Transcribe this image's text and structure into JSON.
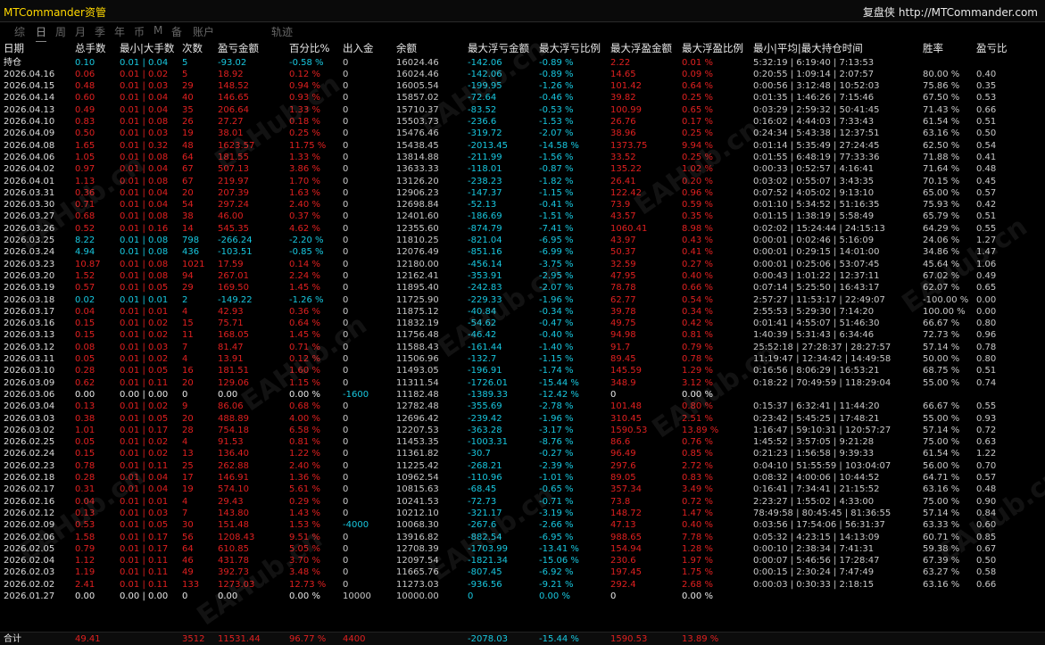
{
  "window": {
    "app_title": "MTCommander资管",
    "right_title": "复盘侠",
    "url": "http://MTCommander.com"
  },
  "tabs": [
    {
      "label": "综",
      "active": false
    },
    {
      "label": "日",
      "active": true
    },
    {
      "label": "周",
      "active": false
    },
    {
      "label": "月",
      "active": false
    },
    {
      "label": "季",
      "active": false
    },
    {
      "label": "年",
      "active": false
    },
    {
      "label": "币",
      "active": false
    },
    {
      "label": "M",
      "active": false
    },
    {
      "label": "备",
      "active": false
    },
    {
      "label": "账户",
      "active": false
    },
    {
      "label": "轨迹",
      "active": false
    }
  ],
  "headers": [
    "日期",
    "总手数",
    "最小|大手数",
    "次数",
    "盈亏金额",
    "百分比%",
    "出入金",
    "余额",
    "最大浮亏金额",
    "最大浮亏比例",
    "最大浮盈金额",
    "最大浮盈比例",
    "最小|平均|最大持仓时间",
    "胜率",
    "盈亏比"
  ],
  "rows": [
    [
      "持仓",
      "0.10",
      "0.01 | 0.04",
      "5",
      "-93.02",
      "-0.58 %",
      "0",
      "16024.46",
      "-142.06",
      "-0.89 %",
      "2.22",
      "0.01 %",
      "5:32:19 | 6:19:40 | 7:13:53",
      "",
      ""
    ],
    [
      "2026.04.16",
      "0.06",
      "0.01 | 0.02",
      "5",
      "18.92",
      "0.12 %",
      "0",
      "16024.46",
      "-142.06",
      "-0.89 %",
      "14.65",
      "0.09 %",
      "0:20:55 | 1:09:14 | 2:07:57",
      "80.00 %",
      "0.40"
    ],
    [
      "2026.04.15",
      "0.48",
      "0.01 | 0.03",
      "29",
      "148.52",
      "0.94 %",
      "0",
      "16005.54",
      "-199.95",
      "-1.26 %",
      "101.42",
      "0.64 %",
      "0:00:56 | 3:12:48 | 10:52:03",
      "75.86 %",
      "0.35"
    ],
    [
      "2026.04.14",
      "0.60",
      "0.01 | 0.04",
      "40",
      "146.65",
      "0.93 %",
      "0",
      "15857.02",
      "-72.64",
      "-0.46 %",
      "39.82",
      "0.25 %",
      "0:01:35 | 1:46:26 | 7:15:46",
      "67.50 %",
      "0.53"
    ],
    [
      "2026.04.13",
      "0.49",
      "0.01 | 0.04",
      "35",
      "206.64",
      "1.33 %",
      "0",
      "15710.37",
      "-83.52",
      "-0.53 %",
      "100.99",
      "0.65 %",
      "0:03:29 | 2:59:32 | 50:41:45",
      "71.43 %",
      "0.66"
    ],
    [
      "2026.04.10",
      "0.83",
      "0.01 | 0.08",
      "26",
      "27.27",
      "0.18 %",
      "0",
      "15503.73",
      "-236.6",
      "-1.53 %",
      "26.76",
      "0.17 %",
      "0:16:02 | 4:44:03 | 7:33:43",
      "61.54 %",
      "0.51"
    ],
    [
      "2026.04.09",
      "0.50",
      "0.01 | 0.03",
      "19",
      "38.01",
      "0.25 %",
      "0",
      "15476.46",
      "-319.72",
      "-2.07 %",
      "38.96",
      "0.25 %",
      "0:24:34 | 5:43:38 | 12:37:51",
      "63.16 %",
      "0.50"
    ],
    [
      "2026.04.08",
      "1.65",
      "0.01 | 0.32",
      "48",
      "1623.57",
      "11.75 %",
      "0",
      "15438.45",
      "-2013.45",
      "-14.58 %",
      "1373.75",
      "9.94 %",
      "0:01:14 | 5:35:49 | 27:24:45",
      "62.50 %",
      "0.54"
    ],
    [
      "2026.04.06",
      "1.05",
      "0.01 | 0.08",
      "64",
      "181.55",
      "1.33 %",
      "0",
      "13814.88",
      "-211.99",
      "-1.56 %",
      "33.52",
      "0.25 %",
      "0:01:55 | 6:48:19 | 77:33:36",
      "71.88 %",
      "0.41"
    ],
    [
      "2026.04.02",
      "0.97",
      "0.01 | 0.04",
      "67",
      "507.13",
      "3.86 %",
      "0",
      "13633.33",
      "-118.01",
      "-0.87 %",
      "135.22",
      "1.02 %",
      "0:00:33 | 0:52:57 | 4:16:41",
      "71.64 %",
      "0.48"
    ],
    [
      "2026.04.01",
      "1.13",
      "0.01 | 0.08",
      "67",
      "219.97",
      "1.70 %",
      "0",
      "13126.20",
      "-238.23",
      "-1.82 %",
      "26.41",
      "0.20 %",
      "0:03:02 | 0:55:07 | 3:43:35",
      "70.15 %",
      "0.45"
    ],
    [
      "2026.03.31",
      "0.36",
      "0.01 | 0.04",
      "20",
      "207.39",
      "1.63 %",
      "0",
      "12906.23",
      "-147.37",
      "-1.15 %",
      "122.42",
      "0.96 %",
      "0:07:52 | 4:05:02 | 9:13:10",
      "65.00 %",
      "0.57"
    ],
    [
      "2026.03.30",
      "0.71",
      "0.01 | 0.04",
      "54",
      "297.24",
      "2.40 %",
      "0",
      "12698.84",
      "-52.13",
      "-0.41 %",
      "73.9",
      "0.59 %",
      "0:01:10 | 5:34:52 | 51:16:35",
      "75.93 %",
      "0.42"
    ],
    [
      "2026.03.27",
      "0.68",
      "0.01 | 0.08",
      "38",
      "46.00",
      "0.37 %",
      "0",
      "12401.60",
      "-186.69",
      "-1.51 %",
      "43.57",
      "0.35 %",
      "0:01:15 | 1:38:19 | 5:58:49",
      "65.79 %",
      "0.51"
    ],
    [
      "2026.03.26",
      "0.52",
      "0.01 | 0.16",
      "14",
      "545.35",
      "4.62 %",
      "0",
      "12355.60",
      "-874.79",
      "-7.41 %",
      "1060.41",
      "8.98 %",
      "0:02:02 | 15:24:44 | 24:15:13",
      "64.29 %",
      "0.55"
    ],
    [
      "2026.03.25",
      "8.22",
      "0.01 | 0.08",
      "798",
      "-266.24",
      "-2.20 %",
      "0",
      "11810.25",
      "-821.04",
      "-6.95 %",
      "43.97",
      "0.43 %",
      "0:00:01 | 0:02:46 | 5:16:09",
      "24.06 %",
      "1.27"
    ],
    [
      "2026.03.24",
      "4.94",
      "0.01 | 0.08",
      "436",
      "-103.51",
      "-0.85 %",
      "0",
      "12076.49",
      "-851.16",
      "-6.99 %",
      "50.37",
      "0.41 %",
      "0:00:01 | 0:29:15 | 14:01:00",
      "34.86 %",
      "1.47"
    ],
    [
      "2026.03.23",
      "10.87",
      "0.01 | 0.08",
      "1021",
      "17.59",
      "0.14 %",
      "0",
      "12180.00",
      "-456.14",
      "-3.75 %",
      "32.59",
      "0.27 %",
      "0:00:01 | 0:25:06 | 53:07:45",
      "45.64 %",
      "1.06"
    ],
    [
      "2026.03.20",
      "1.52",
      "0.01 | 0.08",
      "94",
      "267.01",
      "2.24 %",
      "0",
      "12162.41",
      "-353.91",
      "-2.95 %",
      "47.95",
      "0.40 %",
      "0:00:43 | 1:01:22 | 12:37:11",
      "67.02 %",
      "0.49"
    ],
    [
      "2026.03.19",
      "0.57",
      "0.01 | 0.05",
      "29",
      "169.50",
      "1.45 %",
      "0",
      "11895.40",
      "-242.83",
      "-2.07 %",
      "78.78",
      "0.66 %",
      "0:07:14 | 5:25:50 | 16:43:17",
      "62.07 %",
      "0.65"
    ],
    [
      "2026.03.18",
      "0.02",
      "0.01 | 0.01",
      "2",
      "-149.22",
      "-1.26 %",
      "0",
      "11725.90",
      "-229.33",
      "-1.96 %",
      "62.77",
      "0.54 %",
      "2:57:27 | 11:53:17 | 22:49:07",
      "-100.00 %",
      "0.00"
    ],
    [
      "2026.03.17",
      "0.04",
      "0.01 | 0.01",
      "4",
      "42.93",
      "0.36 %",
      "0",
      "11875.12",
      "-40.84",
      "-0.34 %",
      "39.78",
      "0.34 %",
      "2:55:53 | 5:29:30 | 7:14:20",
      "100.00 %",
      "0.00"
    ],
    [
      "2026.03.16",
      "0.15",
      "0.01 | 0.02",
      "15",
      "75.71",
      "0.64 %",
      "0",
      "11832.19",
      "-54.62",
      "-0.47 %",
      "49.75",
      "0.42 %",
      "0:01:41 | 4:55:07 | 51:46:30",
      "66.67 %",
      "0.80"
    ],
    [
      "2026.03.13",
      "0.15",
      "0.01 | 0.02",
      "11",
      "168.05",
      "1.45 %",
      "0",
      "11756.48",
      "-46.42",
      "-0.40 %",
      "94.98",
      "0.81 %",
      "1:40:39 | 5:31:43 | 6:34:46",
      "72.73 %",
      "0.96"
    ],
    [
      "2026.03.12",
      "0.08",
      "0.01 | 0.03",
      "7",
      "81.47",
      "0.71 %",
      "0",
      "11588.43",
      "-161.44",
      "-1.40 %",
      "91.7",
      "0.79 %",
      "25:52:18 | 27:28:37 | 28:27:57",
      "57.14 %",
      "0.78"
    ],
    [
      "2026.03.11",
      "0.05",
      "0.01 | 0.02",
      "4",
      "13.91",
      "0.12 %",
      "0",
      "11506.96",
      "-132.7",
      "-1.15 %",
      "89.45",
      "0.78 %",
      "11:19:47 | 12:34:42 | 14:49:58",
      "50.00 %",
      "0.80"
    ],
    [
      "2026.03.10",
      "0.28",
      "0.01 | 0.05",
      "16",
      "181.51",
      "1.60 %",
      "0",
      "11493.05",
      "-196.91",
      "-1.74 %",
      "145.59",
      "1.29 %",
      "0:16:56 | 8:06:29 | 16:53:21",
      "68.75 %",
      "0.51"
    ],
    [
      "2026.03.09",
      "0.62",
      "0.01 | 0.11",
      "20",
      "129.06",
      "1.15 %",
      "0",
      "11311.54",
      "-1726.01",
      "-15.44 %",
      "348.9",
      "3.12 %",
      "0:18:22 | 70:49:59 | 118:29:04",
      "55.00 %",
      "0.74"
    ],
    [
      "2026.03.06",
      "0.00",
      "0.00 | 0.00",
      "0",
      "0.00",
      "0.00 %",
      "-1600",
      "11182.48",
      "-1389.33",
      "-12.42 %",
      "0",
      "0.00 %",
      "",
      "",
      ""
    ],
    [
      "2026.03.04",
      "0.13",
      "0.01 | 0.02",
      "9",
      "86.06",
      "0.68 %",
      "0",
      "12782.48",
      "-355.69",
      "-2.78 %",
      "101.48",
      "0.80 %",
      "0:15:37 | 6:32:41 | 11:44:20",
      "66.67 %",
      "0.55"
    ],
    [
      "2026.03.03",
      "0.38",
      "0.01 | 0.05",
      "20",
      "488.89",
      "4.00 %",
      "0",
      "12696.42",
      "-239.42",
      "-1.96 %",
      "310.45",
      "2.51 %",
      "0:23:42 | 5:45:25 | 17:48:21",
      "55.00 %",
      "0.93"
    ],
    [
      "2026.03.02",
      "1.01",
      "0.01 | 0.17",
      "28",
      "754.18",
      "6.58 %",
      "0",
      "12207.53",
      "-363.28",
      "-3.17 %",
      "1590.53",
      "13.89 %",
      "1:16:47 | 59:10:31 | 120:57:27",
      "57.14 %",
      "0.72"
    ],
    [
      "2026.02.25",
      "0.05",
      "0.01 | 0.02",
      "4",
      "91.53",
      "0.81 %",
      "0",
      "11453.35",
      "-1003.31",
      "-8.76 %",
      "86.6",
      "0.76 %",
      "1:45:52 | 3:57:05 | 9:21:28",
      "75.00 %",
      "0.63"
    ],
    [
      "2026.02.24",
      "0.15",
      "0.01 | 0.02",
      "13",
      "136.40",
      "1.22 %",
      "0",
      "11361.82",
      "-30.7",
      "-0.27 %",
      "96.49",
      "0.85 %",
      "0:21:23 | 1:56:58 | 9:39:33",
      "61.54 %",
      "1.22"
    ],
    [
      "2026.02.23",
      "0.78",
      "0.01 | 0.11",
      "25",
      "262.88",
      "2.40 %",
      "0",
      "11225.42",
      "-268.21",
      "-2.39 %",
      "297.6",
      "2.72 %",
      "0:04:10 | 51:55:59 | 103:04:07",
      "56.00 %",
      "0.70"
    ],
    [
      "2026.02.18",
      "0.28",
      "0.01 | 0.04",
      "17",
      "146.91",
      "1.36 %",
      "0",
      "10962.54",
      "-110.96",
      "-1.01 %",
      "89.05",
      "0.83 %",
      "0:08:32 | 4:00:06 | 10:44:52",
      "64.71 %",
      "0.57"
    ],
    [
      "2026.02.17",
      "0.31",
      "0.01 | 0.04",
      "19",
      "574.10",
      "5.61 %",
      "0",
      "10815.63",
      "-68.45",
      "-0.65 %",
      "357.34",
      "3.49 %",
      "0:16:41 | 7:34:41 | 21:15:52",
      "63.16 %",
      "0.48"
    ],
    [
      "2026.02.16",
      "0.04",
      "0.01 | 0.01",
      "4",
      "29.43",
      "0.29 %",
      "0",
      "10241.53",
      "-72.73",
      "-0.71 %",
      "73.8",
      "0.72 %",
      "2:23:27 | 1:55:02 | 4:33:00",
      "75.00 %",
      "0.90"
    ],
    [
      "2026.02.12",
      "0.13",
      "0.01 | 0.03",
      "7",
      "143.80",
      "1.43 %",
      "0",
      "10212.10",
      "-321.17",
      "-3.19 %",
      "148.72",
      "1.47 %",
      "78:49:58 | 80:45:45 | 81:36:55",
      "57.14 %",
      "0.84"
    ],
    [
      "2026.02.09",
      "0.53",
      "0.01 | 0.05",
      "30",
      "151.48",
      "1.53 %",
      "-4000",
      "10068.30",
      "-267.6",
      "-2.66 %",
      "47.13",
      "0.40 %",
      "0:03:56 | 17:54:06 | 56:31:37",
      "63.33 %",
      "0.60"
    ],
    [
      "2026.02.06",
      "1.58",
      "0.01 | 0.17",
      "56",
      "1208.43",
      "9.51 %",
      "0",
      "13916.82",
      "-882.54",
      "-6.95 %",
      "988.65",
      "7.78 %",
      "0:05:32 | 4:23:15 | 14:13:09",
      "60.71 %",
      "0.85"
    ],
    [
      "2026.02.05",
      "0.79",
      "0.01 | 0.17",
      "64",
      "610.85",
      "5.05 %",
      "0",
      "12708.39",
      "-1703.99",
      "-13.41 %",
      "154.94",
      "1.28 %",
      "0:00:10 | 2:38:34 | 7:41:31",
      "59.38 %",
      "0.67"
    ],
    [
      "2026.02.04",
      "1.12",
      "0.01 | 0.11",
      "46",
      "431.78",
      "3.70 %",
      "0",
      "12097.54",
      "-1821.34",
      "-15.06 %",
      "230.6",
      "1.97 %",
      "0:00:07 | 5:46:56 | 17:28:47",
      "67.39 %",
      "0.50"
    ],
    [
      "2026.02.03",
      "1.19",
      "0.01 | 0.11",
      "49",
      "392.73",
      "3.48 %",
      "0",
      "11665.76",
      "-807.45",
      "-6.92 %",
      "197.45",
      "1.75 %",
      "0:00:15 | 2:30:24 | 7:47:49",
      "63.27 %",
      "0.58"
    ],
    [
      "2026.02.02",
      "2.41",
      "0.01 | 0.11",
      "133",
      "1273.03",
      "12.73 %",
      "0",
      "11273.03",
      "-936.56",
      "-9.21 %",
      "292.4",
      "2.68 %",
      "0:00:03 | 0:30:33 | 2:18:15",
      "63.16 %",
      "0.66"
    ],
    [
      "2026.01.27",
      "0.00",
      "0.00 | 0.00",
      "0",
      "0.00",
      "0.00 %",
      "10000",
      "10000.00",
      "0",
      "0.00 %",
      "0",
      "0.00 %",
      "",
      "",
      ""
    ]
  ],
  "total": [
    "合计",
    "49.41",
    "",
    "3512",
    "11531.44",
    "96.77 %",
    "4400",
    "",
    "-2078.03",
    "-15.44 %",
    "1590.53",
    "13.89 %",
    "",
    "",
    ""
  ],
  "watermark": "EAHub.cn"
}
